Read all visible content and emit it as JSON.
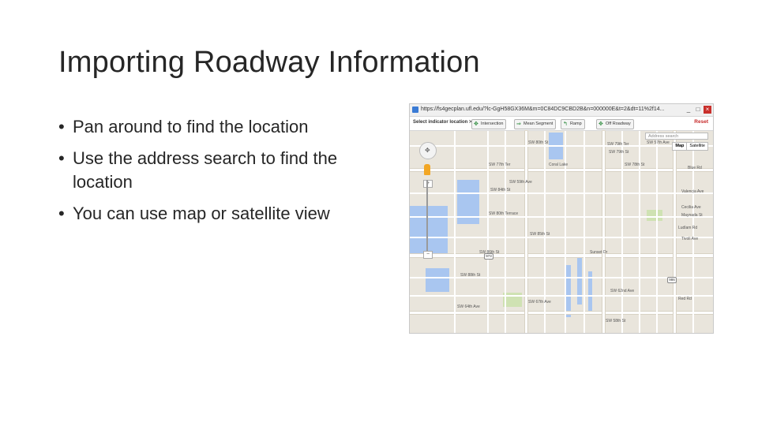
{
  "slide": {
    "title": "Importing Roadway Information",
    "bullets": [
      "Pan around to find the location",
      "Use the address search to find the location",
      "You can use map or satellite view"
    ]
  },
  "browser": {
    "url": "https://fs4gecplan.ufl.edu/?lc-GgH58GX36M&m=0C84DC9CBD2B&n=000000E&t=2&dt=11%2f14...",
    "controls": {
      "minimize": "_",
      "maximize": "□",
      "close": "×"
    }
  },
  "toolbar": {
    "label": "Select indicator location >",
    "buttons": [
      "Intersection",
      "Mean Segment",
      "Ramp",
      "Off Roadway"
    ],
    "reset": "Reset"
  },
  "map": {
    "search_placeholder": "Address search",
    "map_types": [
      "Map",
      "Satellite"
    ],
    "zoom_in": "+",
    "zoom_out": "−",
    "labels": [
      "SW 80th St",
      "SW 79th Ter",
      "SW 79th St",
      "SW 78th St",
      "SW 77th Ter",
      "Coral Lake",
      "SW 80th Terrace",
      "Blue Rd",
      "Valencia Ave",
      "Cecilia Ave",
      "SW 84th St",
      "SW 85th St",
      "SW 86th St",
      "SW 88th St",
      "Sunset Dr",
      "SW 57th Ave",
      "SW 59th Ave",
      "SW 62nd Ave",
      "SW 64th Ave",
      "SW 67th Ave",
      "Red Rd",
      "SW 58th St",
      "Ludlam Rd",
      "Tivoli Ave",
      "Maynada St"
    ],
    "badges": [
      "973",
      "986"
    ]
  }
}
